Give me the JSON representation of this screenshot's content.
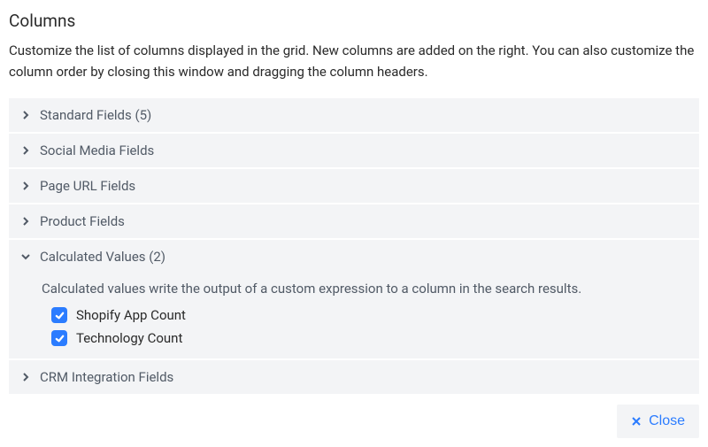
{
  "title": "Columns",
  "description": "Customize the list of columns displayed in the grid. New columns are added on the right. You can also customize the column order by closing this window and dragging the column headers.",
  "sections": {
    "standard": {
      "label": "Standard Fields (5)",
      "expanded": false
    },
    "social": {
      "label": "Social Media Fields",
      "expanded": false
    },
    "pageurl": {
      "label": "Page URL Fields",
      "expanded": false
    },
    "product": {
      "label": "Product Fields",
      "expanded": false
    },
    "calculated": {
      "label": "Calculated Values (2)",
      "expanded": true,
      "description": "Calculated values write the output of a custom expression to a column in the search results.",
      "items": [
        {
          "label": "Shopify App Count",
          "checked": true
        },
        {
          "label": "Technology Count",
          "checked": true
        }
      ]
    },
    "crm": {
      "label": "CRM Integration Fields",
      "expanded": false
    }
  },
  "footer": {
    "close_label": "Close"
  }
}
